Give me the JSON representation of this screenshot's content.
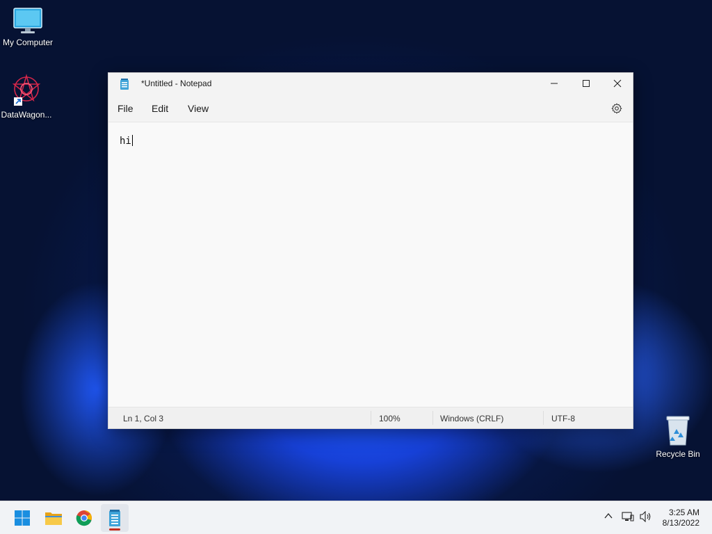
{
  "desktop": {
    "icons": [
      {
        "label": "My Computer"
      },
      {
        "label": "DataWagon..."
      },
      {
        "label": "Recycle Bin"
      }
    ]
  },
  "window": {
    "title": "*Untitled - Notepad",
    "menu": [
      "File",
      "Edit",
      "View"
    ],
    "content": "hi",
    "status": {
      "position": "Ln 1, Col 3",
      "zoom": "100%",
      "line_ending": "Windows (CRLF)",
      "encoding": "UTF-8"
    }
  },
  "taskbar": {
    "apps": [
      "start-icon",
      "file-explorer-icon",
      "chrome-icon",
      "notepad-icon"
    ],
    "active_app": "notepad-icon",
    "clock": {
      "time": "3:25 AM",
      "date": "8/13/2022"
    }
  }
}
